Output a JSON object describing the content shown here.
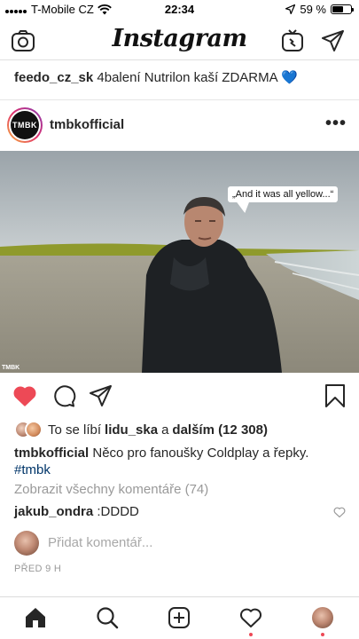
{
  "status_bar": {
    "carrier": "T-Mobile CZ",
    "time": "22:34",
    "battery_text": "59 %",
    "battery_level": 0.59
  },
  "app": {
    "title": "Instagram"
  },
  "promo": {
    "username": "feedo_cz_sk",
    "text": "4balení Nutrilon kaší ZDARMA 💙"
  },
  "post": {
    "username": "tmbkofficial",
    "avatar_text": "TMBK",
    "more": "•••",
    "speech_bubble": "„And it was all yellow...“",
    "watermark": "TMBK",
    "likes": {
      "prefix": "To se líbí",
      "user": "lidu_ska",
      "joiner": "a",
      "others": "dalším (12 308)"
    },
    "caption": {
      "username": "tmbkofficial",
      "text": "Něco pro fanoušky Coldplay a řepky.",
      "hashtag": "#tmbk"
    },
    "view_all_comments": "Zobrazit všechny komentáře (74)",
    "comment": {
      "username": "jakub_ondra",
      "text": ":DDDD"
    },
    "add_comment_placeholder": "Přidat komentář...",
    "time_ago": "PŘED 9 H",
    "liked": true
  },
  "colors": {
    "like_red": "#ed4956",
    "hashtag": "#003569",
    "muted": "#999999"
  }
}
